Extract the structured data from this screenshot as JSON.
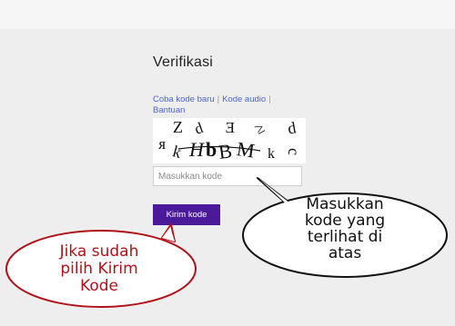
{
  "page": {
    "title": "Verifikasi"
  },
  "links": {
    "try_new": "Coba kode baru",
    "audio": "Kode audio",
    "help": "Bantuan"
  },
  "captcha": {
    "text": "ʁZdƎ≥dkHbBMkc"
  },
  "input": {
    "placeholder": "Masukkan kode",
    "value": ""
  },
  "submit": {
    "label": "Kirim kode"
  },
  "callouts": {
    "right": [
      "Masukkan",
      "kode yang",
      "terlihat di",
      "atas"
    ],
    "left": [
      "Jika sudah",
      "pilih Kirim",
      "Kode"
    ]
  },
  "colors": {
    "button": "#4a1a9b",
    "link": "#4a66c8",
    "left_callout": "#b1121a",
    "background": "#efeeee"
  }
}
